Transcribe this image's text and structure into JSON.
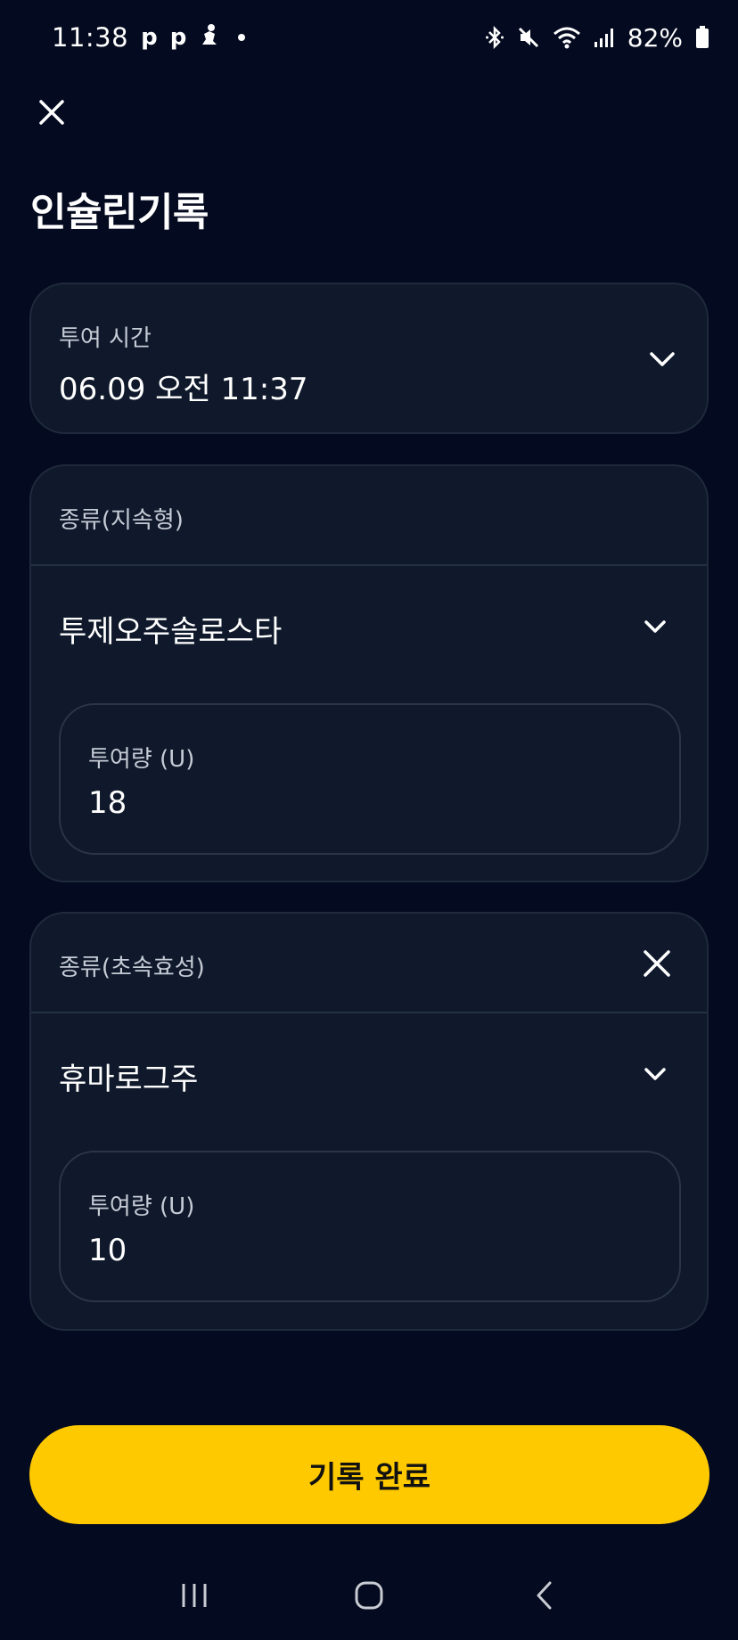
{
  "status_bar": {
    "time": "11:38",
    "notif_icons": [
      "p",
      "p"
    ],
    "battery": "82%"
  },
  "page": {
    "title": "인슐린기록"
  },
  "admin_time": {
    "label": "투여 시간",
    "value": "06.09 오전 11:37"
  },
  "insulin_entries": [
    {
      "type_label": "종류(지속형)",
      "product": "투제오주솔로스타",
      "dose_label": "투여량 (U)",
      "dose_value": "18",
      "removable": false
    },
    {
      "type_label": "종류(초속효성)",
      "product": "휴마로그주",
      "dose_label": "투여량 (U)",
      "dose_value": "10",
      "removable": true
    }
  ],
  "submit": {
    "label": "기록 완료"
  },
  "colors": {
    "background": "#040a1f",
    "card": "#0f192b",
    "accent": "#ffc900"
  },
  "icons": {
    "close": "close-icon",
    "chevron": "chevron-down-icon",
    "nav": [
      "recent-apps-icon",
      "home-icon",
      "back-icon"
    ]
  }
}
